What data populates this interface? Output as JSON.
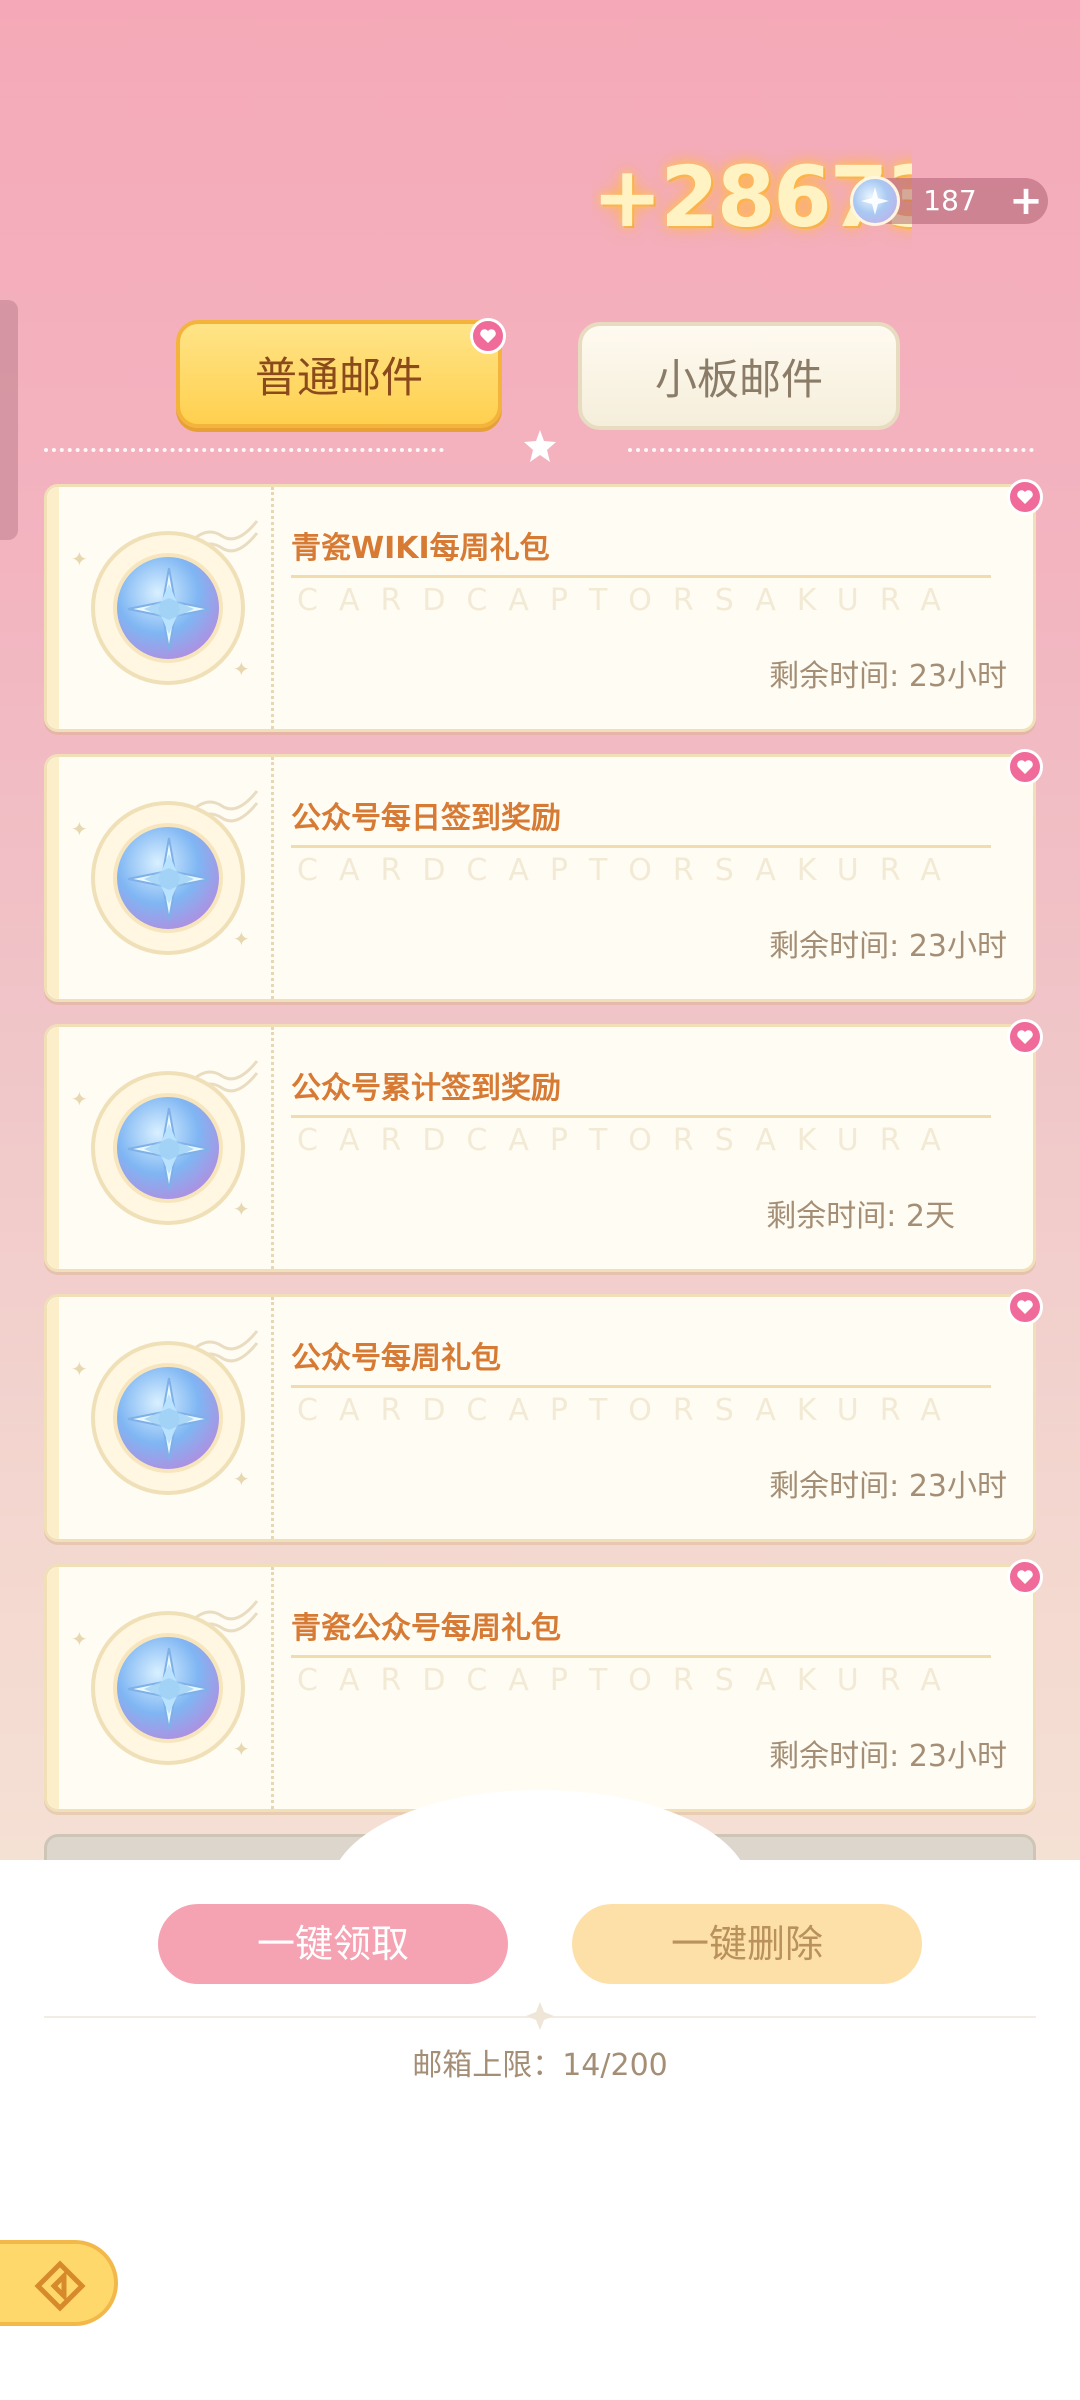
{
  "top_bar": {
    "gain_text": "+28673",
    "currency_value": "187",
    "currency_icon": "star-crystal-icon",
    "plus_icon": "plus-icon"
  },
  "tabs": [
    {
      "label": "普通邮件",
      "active": true
    },
    {
      "label": "小板邮件",
      "active": false
    }
  ],
  "mails": [
    {
      "title": "青瓷WIKI每周礼包",
      "watermark": "CARDCAPTORSAKURA",
      "remaining": "剩余时间: 23小时"
    },
    {
      "title": "公众号每日签到奖励",
      "watermark": "CARDCAPTORSAKURA",
      "remaining": "剩余时间: 23小时"
    },
    {
      "title": "公众号累计签到奖励",
      "watermark": "CARDCAPTORSAKURA",
      "remaining": "剩余时间: 2天"
    },
    {
      "title": "公众号每周礼包",
      "watermark": "CARDCAPTORSAKURA",
      "remaining": "剩余时间: 23小时"
    },
    {
      "title": "青瓷公众号每周礼包",
      "watermark": "CARDCAPTORSAKURA",
      "remaining": "剩余时间: 23小时"
    }
  ],
  "actions": {
    "claim_all": "一键领取",
    "delete_all": "一键删除"
  },
  "mailbox_limit": "邮箱上限：14/200",
  "colors": {
    "accent_pink": "#f06a9a",
    "tab_gold": "#ffd04f",
    "title_orange": "#d67a34"
  }
}
